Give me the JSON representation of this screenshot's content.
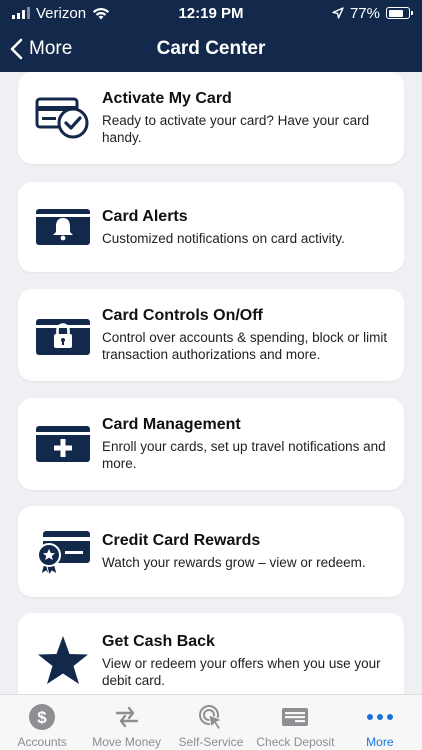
{
  "status_bar": {
    "carrier": "Verizon",
    "time": "12:19 PM",
    "battery": "77%",
    "battery_level": 0.77
  },
  "nav": {
    "back_label": "More",
    "title": "Card Center"
  },
  "colors": {
    "nav_bg": "#13294b",
    "icon": "#13294b",
    "active_tab": "#1a73d9",
    "inactive_tab": "#8e8e93"
  },
  "cards": [
    {
      "icon": "card-check-icon",
      "title": "Activate My Card",
      "desc": "Ready to activate your card? Have your card handy."
    },
    {
      "icon": "card-bell-icon",
      "title": "Card Alerts",
      "desc": "Customized notifications on card activity."
    },
    {
      "icon": "card-lock-icon",
      "title": "Card Controls On/Off",
      "desc": "Control over accounts & spending, block or limit transaction authorizations and more."
    },
    {
      "icon": "card-plus-icon",
      "title": "Card Management",
      "desc": "Enroll your cards, set up travel notifications and more."
    },
    {
      "icon": "card-ribbon-icon",
      "title": "Credit Card Rewards",
      "desc": "Watch your rewards grow – view or redeem."
    },
    {
      "icon": "star-icon",
      "title": "Get Cash Back",
      "desc": "View or redeem your offers when you use your debit card."
    }
  ],
  "tabs": [
    {
      "icon": "dollar-icon",
      "label": "Accounts"
    },
    {
      "icon": "transfer-arrows-icon",
      "label": "Move Money"
    },
    {
      "icon": "pointer-click-icon",
      "label": "Self-Service"
    },
    {
      "icon": "check-icon",
      "label": "Check Deposit"
    },
    {
      "icon": "ellipsis-icon",
      "label": "More",
      "active": true
    }
  ]
}
